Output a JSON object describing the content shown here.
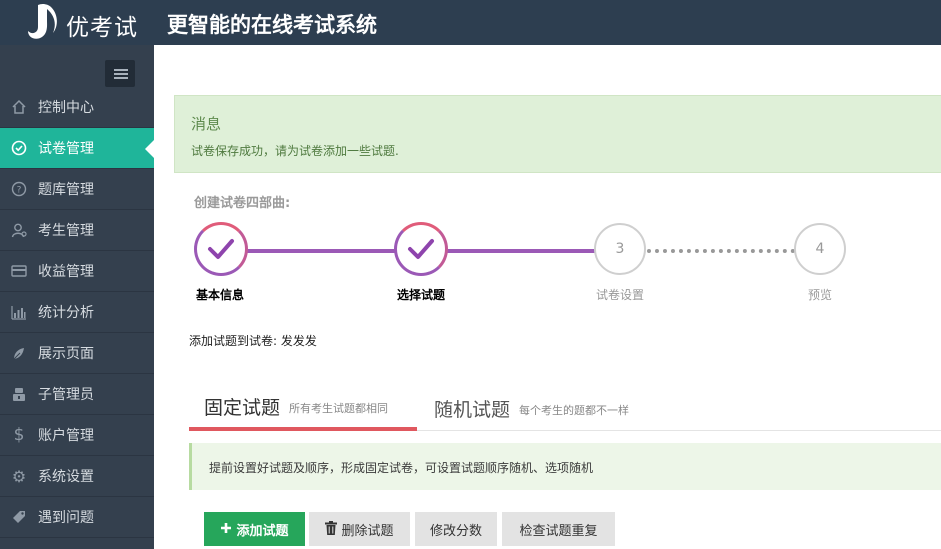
{
  "header": {
    "brand": "优考试",
    "slogan": "更智能的在线考试系统"
  },
  "sidebar": {
    "items": [
      {
        "label": "控制中心",
        "icon": "home-icon",
        "active": false
      },
      {
        "label": "试卷管理",
        "icon": "check-circle-icon",
        "active": true
      },
      {
        "label": "题库管理",
        "icon": "question-circle-icon",
        "active": false
      },
      {
        "label": "考生管理",
        "icon": "user-icon",
        "active": false
      },
      {
        "label": "收益管理",
        "icon": "credit-card-icon",
        "active": false
      },
      {
        "label": "统计分析",
        "icon": "bar-chart-icon",
        "active": false
      },
      {
        "label": "展示页面",
        "icon": "leaf-icon",
        "active": false
      },
      {
        "label": "子管理员",
        "icon": "admin-icon",
        "active": false
      },
      {
        "label": "账户管理",
        "icon": "dollar-icon",
        "active": false
      },
      {
        "label": "系统设置",
        "icon": "gear-icon",
        "active": false
      },
      {
        "label": "遇到问题",
        "icon": "tag-icon",
        "active": false
      }
    ]
  },
  "alert": {
    "title": "消息",
    "message": "试卷保存成功，请为试卷添加一些试题."
  },
  "steps": {
    "title": "创建试卷四部曲:",
    "items": [
      {
        "label": "基本信息",
        "status": "done",
        "number": ""
      },
      {
        "label": "选择试题",
        "status": "done",
        "number": ""
      },
      {
        "label": "试卷设置",
        "status": "todo",
        "number": "3"
      },
      {
        "label": "预览",
        "status": "todo",
        "number": "4"
      }
    ]
  },
  "paper_info": "添加试题到试卷: 发发发",
  "tabs": [
    {
      "label": "固定试题",
      "sub": "所有考生试题都相同",
      "active": true
    },
    {
      "label": "随机试题",
      "sub": "每个考生的题都不一样",
      "active": false
    }
  ],
  "hint": "提前设置好试题及顺序，形成固定试卷，可设置试题顺序随机、选项随机",
  "buttons": {
    "add": "添加试题",
    "delete": "删除试题",
    "score": "修改分数",
    "check": "检查试题重复"
  },
  "colors": {
    "topbar": "#2d3e50",
    "sidebar": "#34404e",
    "active": "#1fb59a",
    "step_done": "#9b59b6",
    "tab_accent": "#e0585f",
    "add_button": "#26a65b"
  }
}
